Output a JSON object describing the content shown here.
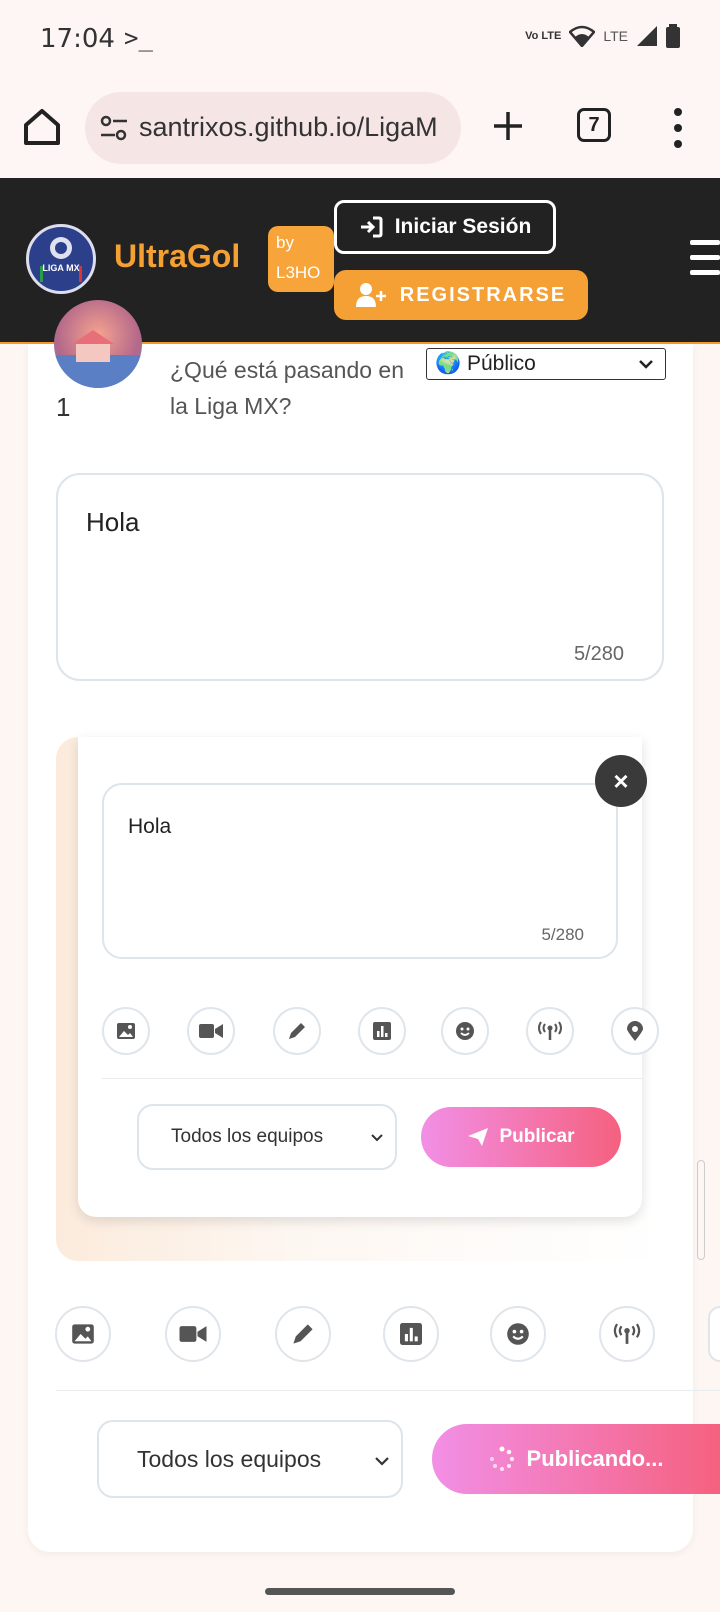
{
  "status_bar": {
    "time": "17:04",
    "terminal_glyph": ">_",
    "volte": "Vo LTE",
    "lte": "LTE",
    "icons": [
      "wifi-icon",
      "signal-icon",
      "battery-icon"
    ]
  },
  "browser": {
    "url": "santrixos.github.io/LigaM",
    "tab_count": "7",
    "icons": [
      "home-icon",
      "site-settings-icon",
      "new-tab-icon",
      "more-menu-icon"
    ]
  },
  "header": {
    "brand": "UltraGol",
    "logo_text": "LIGA MX",
    "by_line1": "by",
    "by_line2": "L3HO",
    "login_label": "Iniciar Sesión",
    "register_label": "REGISTRARSE",
    "colors": {
      "accent": "#f5a033",
      "background": "#222222"
    }
  },
  "composer": {
    "avatar_count": "1",
    "prompt": "¿Qué está pasando en la Liga MX?",
    "visibility": "🌍 Público",
    "text": "Hola",
    "char_count": "5/280",
    "team_select": "Todos los equipos",
    "publish_status_label": "Publicando..."
  },
  "preview": {
    "text": "Hola",
    "char_count": "5/280",
    "close_label": "×",
    "team_select": "Todos los equipos",
    "publish_label": "Publicar"
  },
  "tools": [
    "image-icon",
    "video-icon",
    "pencil-icon",
    "poll-icon",
    "emoji-icon",
    "live-icon",
    "location-icon"
  ],
  "colors": {
    "publish_gradient_start": "#f28fe6",
    "publish_gradient_end": "#f5617f"
  }
}
